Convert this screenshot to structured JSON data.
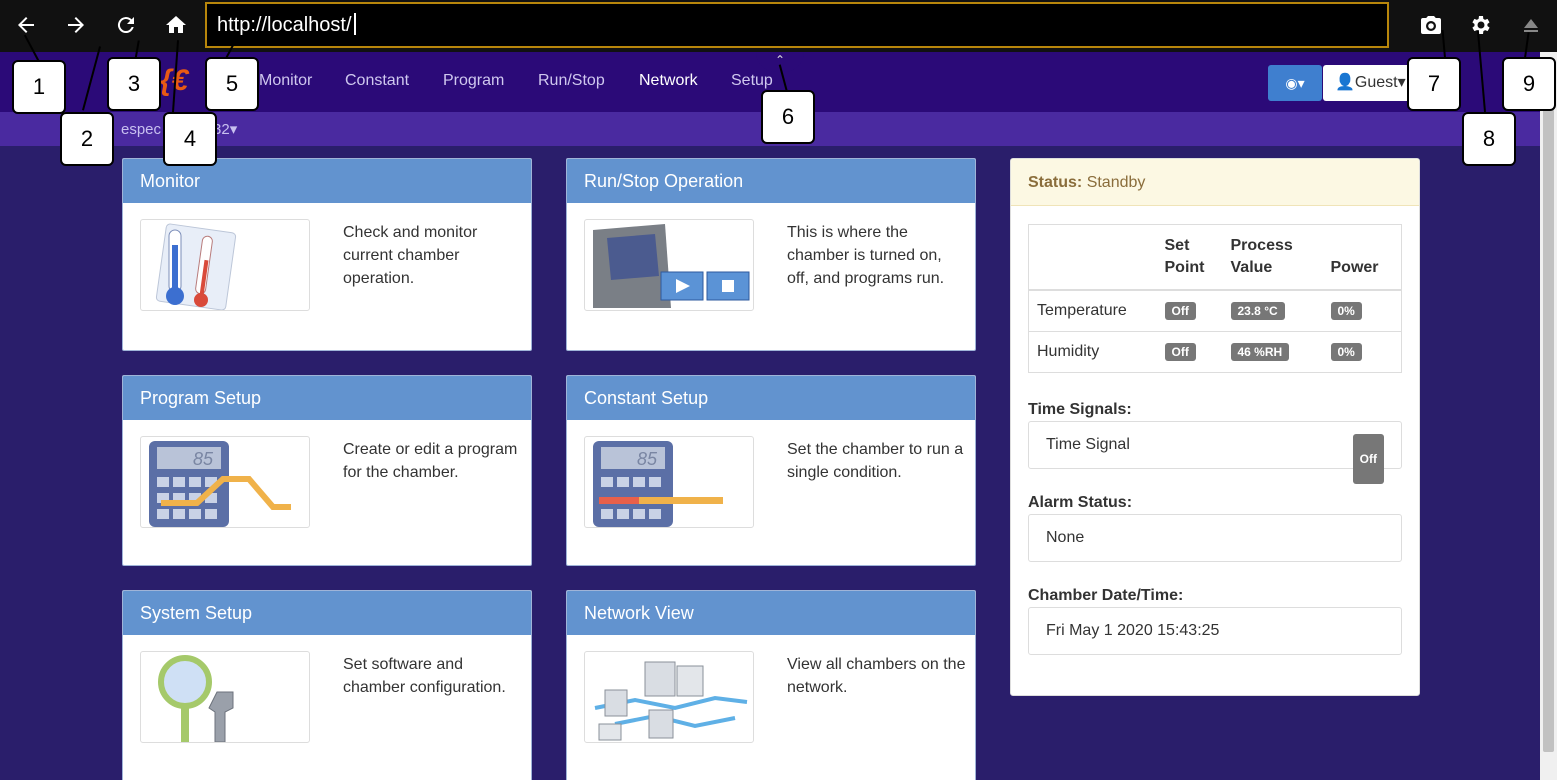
{
  "browser": {
    "url": "http://localhost/",
    "icons": [
      "back-icon",
      "forward-icon",
      "reload-icon",
      "home-icon",
      "camera-icon",
      "gear-icon",
      "eject-icon"
    ]
  },
  "nav": {
    "links": [
      "Monitor",
      "Constant",
      "Program",
      "Run/Stop",
      "Network",
      "Setup"
    ],
    "active": "Network",
    "user": "Guest"
  },
  "subbar": {
    "chamber_visible_left": "espec",
    "chamber_visible_right": "32"
  },
  "cards": [
    {
      "title": "Monitor",
      "text": "Check and monitor current chamber operation."
    },
    {
      "title": "Run/Stop Operation",
      "text": "This is where the chamber is turned on, off, and programs run."
    },
    {
      "title": "Program Setup",
      "text": "Create or edit a program for the chamber."
    },
    {
      "title": "Constant Setup",
      "text": "Set the chamber to run a single condition."
    },
    {
      "title": "System Setup",
      "text": "Set software and chamber configuration."
    },
    {
      "title": "Network View",
      "text": "View all chambers on the network."
    }
  ],
  "status": {
    "label": "Status:",
    "value": "Standby",
    "table_headers": [
      "Set Point",
      "Process Value",
      "Power"
    ],
    "rows": [
      {
        "name": "Temperature",
        "set_point": "Off",
        "process_value": "23.8 °C",
        "power": "0%"
      },
      {
        "name": "Humidity",
        "set_point": "Off",
        "process_value": "46 %RH",
        "power": "0%"
      }
    ],
    "time_signals_label": "Time Signals:",
    "time_signal_name": "Time Signal",
    "time_signal_value": "Off",
    "alarm_label": "Alarm Status:",
    "alarm_value": "None",
    "datetime_label": "Chamber Date/Time:",
    "datetime_value": "Fri May 1 2020 15:43:25"
  },
  "callouts": [
    "1",
    "2",
    "3",
    "4",
    "5",
    "6",
    "7",
    "8",
    "9"
  ]
}
